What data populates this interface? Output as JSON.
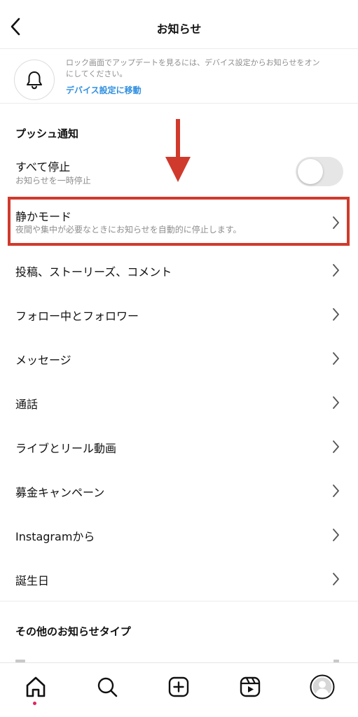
{
  "header": {
    "title": "お知らせ"
  },
  "banner": {
    "text": "ロック画面でアップデートを見るには、デバイス設定からお知らせをオンにしてください。",
    "link": "デバイス設定に移動"
  },
  "push_section": {
    "heading": "プッシュ通知",
    "pause_all": {
      "label": "すべて停止",
      "sub": "お知らせを一時停止",
      "toggle_on": false
    },
    "quiet_mode": {
      "label": "静かモード",
      "sub": "夜間や集中が必要なときにお知らせを自動的に停止します。"
    },
    "items": [
      {
        "label": "投稿、ストーリーズ、コメント"
      },
      {
        "label": "フォロー中とフォロワー"
      },
      {
        "label": "メッセージ"
      },
      {
        "label": "通話"
      },
      {
        "label": "ライブとリール動画"
      },
      {
        "label": "募金キャンペーン"
      },
      {
        "label": "Instagramから"
      },
      {
        "label": "誕生日"
      }
    ]
  },
  "other_section": {
    "heading": "その他のお知らせタイプ"
  },
  "tabbar": {
    "tabs": [
      "home-icon",
      "search-icon",
      "create-icon",
      "reels-icon",
      "profile-icon"
    ],
    "active": "home-icon"
  },
  "colors": {
    "annotation_red": "#d03a2c",
    "link_blue": "#2f8fe0",
    "notification_dot": "#e0245e"
  }
}
